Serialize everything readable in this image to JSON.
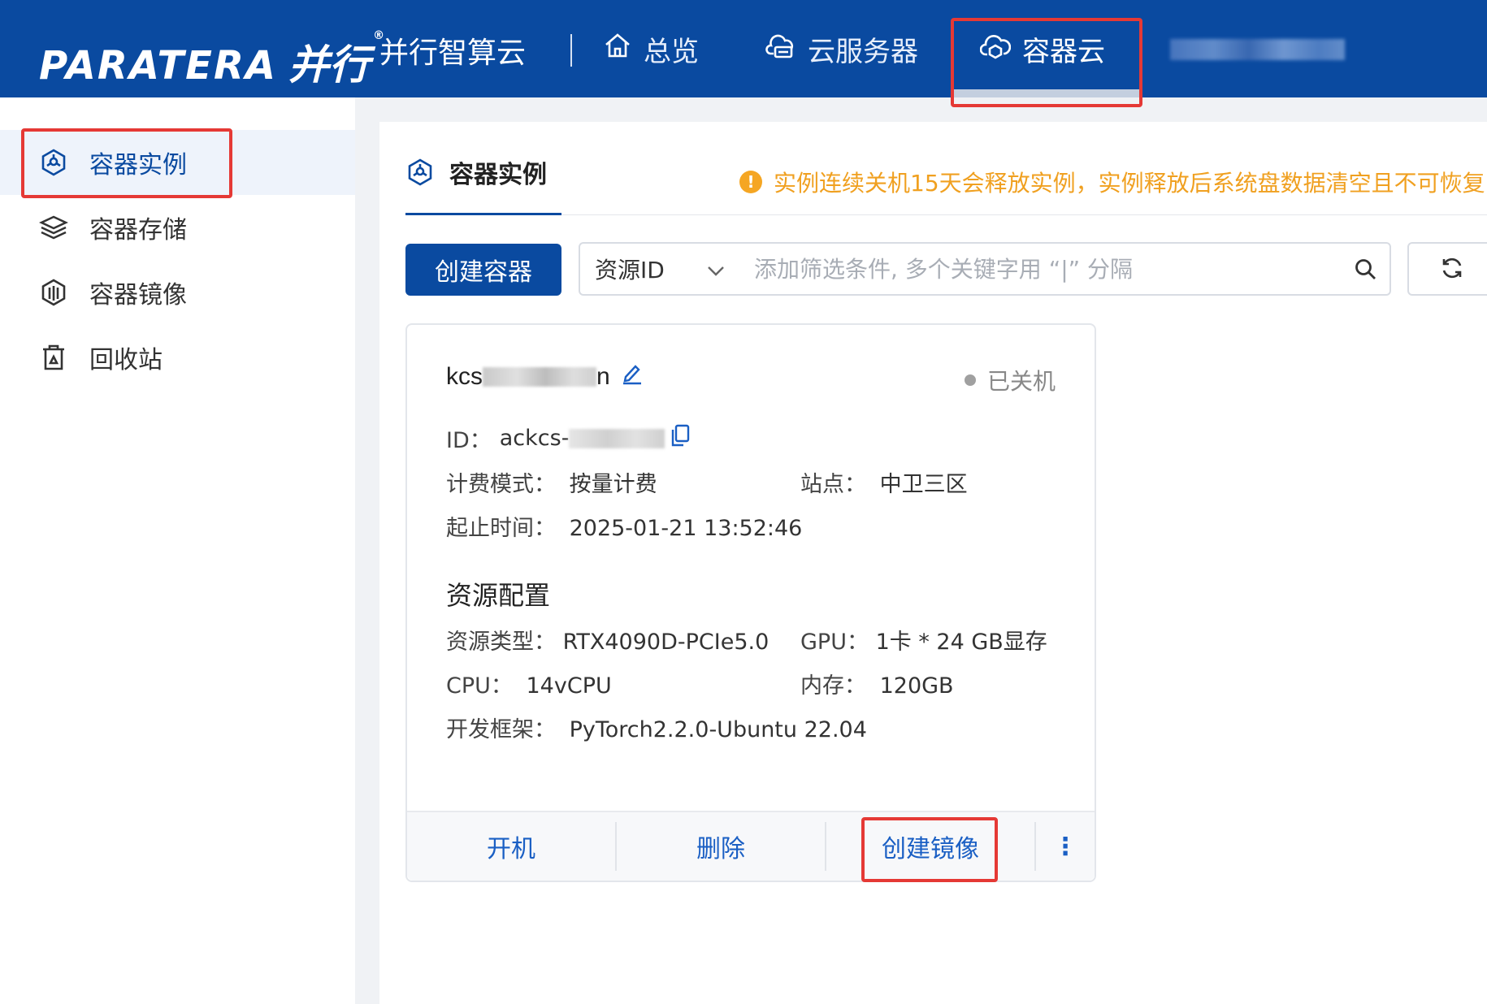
{
  "header": {
    "logo_en": "PARATERA",
    "logo_cn": "并行",
    "logo_reg": "®",
    "product": "并行智算云",
    "nav": [
      {
        "label": "总览",
        "icon": "home-icon"
      },
      {
        "label": "云服务器",
        "icon": "cloud-server-icon"
      },
      {
        "label": "容器云",
        "icon": "cloud-container-icon",
        "active": true
      }
    ]
  },
  "sidebar": {
    "items": [
      {
        "label": "容器实例",
        "icon": "container-instance-icon",
        "active": true
      },
      {
        "label": "容器存储",
        "icon": "layers-icon"
      },
      {
        "label": "容器镜像",
        "icon": "image-icon"
      },
      {
        "label": "回收站",
        "icon": "recycle-bin-icon"
      }
    ]
  },
  "main": {
    "tab_title": "容器实例",
    "notice": "实例连续关机15天会释放实例，实例释放后系统盘数据清空且不可恢复",
    "create_button": "创建容器",
    "search": {
      "select_value": "资源ID",
      "placeholder": "添加筛选条件, 多个关键字用 “|” 分隔"
    }
  },
  "card": {
    "name_prefix": "kcs",
    "name_suffix": "n",
    "status": "已关机",
    "id_label": "ID：",
    "id_value": "ackcs-",
    "billing_label": "计费模式：",
    "billing_value": "按量计费",
    "site_label": "站点：",
    "site_value": "中卫三区",
    "time_label": "起止时间：",
    "time_value": "2025-01-21 13:52:46",
    "section_title": "资源配置",
    "res_type_label": "资源类型：",
    "res_type_value": "RTX4090D-PCIe5.0",
    "gpu_label": "GPU：",
    "gpu_value": "1卡 * 24 GB显存",
    "cpu_label": "CPU：",
    "cpu_value": "14vCPU",
    "mem_label": "内存：",
    "mem_value": "120GB",
    "framework_label": "开发框架：",
    "framework_value": "PyTorch2.2.0-Ubuntu 22.04",
    "actions": {
      "start": "开机",
      "delete": "删除",
      "create_image": "创建镜像",
      "more": "⋮"
    }
  },
  "colors": {
    "brand": "#0a4aa0",
    "highlight": "#e53935",
    "warning": "#f0a020",
    "link": "#1a5fc4"
  }
}
